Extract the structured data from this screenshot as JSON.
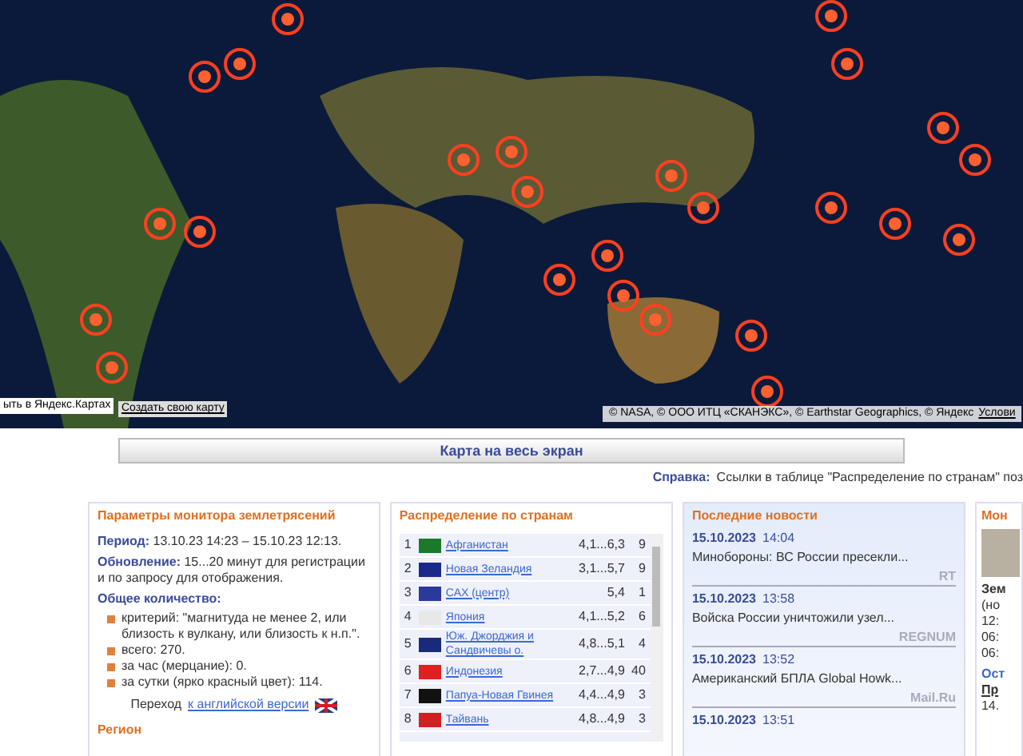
{
  "map": {
    "open_link": "ыть в Яндекс.Картах",
    "create_link": "Создать свою карту",
    "attribution": "© NASA, © ООО ИТЦ «СКАНЭКС», © Earthstar Geographics, © Яндекс",
    "terms_link": "Услови"
  },
  "fullscreen_button": "Карта на весь экран",
  "help": {
    "label": "Справка:",
    "text": "Ссылки в таблице \"Распределение по странам\" поз"
  },
  "params": {
    "title": "Параметры монитора землетрясений",
    "lines": [
      {
        "label": "Период:",
        "text": "13.10.23 14:23 – 15.10.23 12:13."
      },
      {
        "label": "Обновление:",
        "text": "15...20 минут для регистрации и по запросу для отображения."
      }
    ],
    "count_title": "Общее количество:",
    "bullets": [
      "критерий: \"магнитуда не менее 2, или близость к вулкану, или близость к н.п.\".",
      "всего: 270.",
      "за час (мерцание): 0.",
      "за сутки (ярко красный цвет): 114."
    ],
    "switch_text": "Переход",
    "switch_link": "к английской версии",
    "region_title": "Регион"
  },
  "countries": {
    "title": "Распределение по странам",
    "rows": [
      {
        "n": "1",
        "name": "Афганистан",
        "range": "4,1...6,3",
        "count": "9",
        "color": "#1a7a2a"
      },
      {
        "n": "2",
        "name": "Новая Зеландия",
        "range": "3,1...5,7",
        "count": "9",
        "color": "#1a2a8a"
      },
      {
        "n": "3",
        "name": "САХ (центр)",
        "range": "5,4",
        "count": "1",
        "color": "#2a3a9a"
      },
      {
        "n": "4",
        "name": "Япония",
        "range": "4,1...5,2",
        "count": "6",
        "color": "#e8e8e8"
      },
      {
        "n": "5",
        "name": "Юж. Джорджия и Сандвичевы о.",
        "range": "4,8...5,1",
        "count": "4",
        "color": "#1a2a7a"
      },
      {
        "n": "6",
        "name": "Индонезия",
        "range": "2,7...4,9",
        "count": "40",
        "color": "#e02020"
      },
      {
        "n": "7",
        "name": "Папуа-Новая Гвинея",
        "range": "4,4...4,9",
        "count": "3",
        "color": "#111111"
      },
      {
        "n": "8",
        "name": "Тайвань",
        "range": "4,8...4,9",
        "count": "3",
        "color": "#d02020"
      }
    ]
  },
  "news": {
    "title": "Последние новости",
    "items": [
      {
        "date": "15.10.2023",
        "time": "14:04",
        "headline": "Минобороны: ВС России пресекли...",
        "source": "RT"
      },
      {
        "date": "15.10.2023",
        "time": "13:58",
        "headline": "Войска России уничтожили узел...",
        "source": "REGNUM"
      },
      {
        "date": "15.10.2023",
        "time": "13:52",
        "headline": "Американский БПЛА Global Howk...",
        "source": "Mail.Ru"
      },
      {
        "date": "15.10.2023",
        "time": "13:51"
      }
    ]
  },
  "side": {
    "title": "Мон",
    "lines": [
      "Зем",
      "(но",
      "12:",
      "06:",
      "06:"
    ],
    "subtitle": "Ост",
    "link": "Пр",
    "date": "14."
  }
}
